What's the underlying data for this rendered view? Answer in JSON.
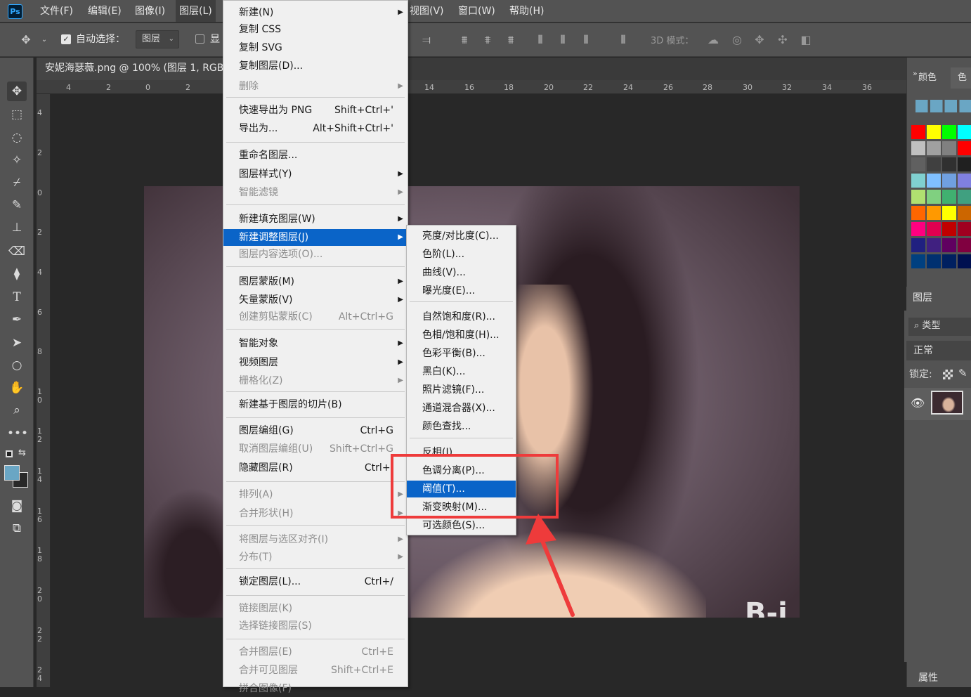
{
  "app": {
    "logo": "Ps"
  },
  "menubar": {
    "items": [
      "文件(F)",
      "编辑(E)",
      "图像(I)",
      "图层(L)",
      "视图(V)",
      "窗口(W)",
      "帮助(H)"
    ]
  },
  "options": {
    "auto_select_label": "自动选择：",
    "layer_select_value": "图层",
    "show_label": "显",
    "mode_3d_label": "3D 模式："
  },
  "document": {
    "tab_title": "安妮海瑟薇.png @ 100% (图层 1, RGB",
    "ruler_h": [
      "4",
      "2",
      "0",
      "2",
      "14",
      "16",
      "18",
      "20",
      "22",
      "24",
      "26",
      "28",
      "30",
      "32",
      "34",
      "36"
    ],
    "ruler_v": [
      "4",
      "2",
      "0",
      "2",
      "4",
      "6",
      "8",
      "1 0",
      "1 2",
      "1 4",
      "1 6",
      "1 8",
      "2 0",
      "2 2",
      "2 4"
    ],
    "watermark": "B-i"
  },
  "right_panel": {
    "tab_color": "颜色",
    "tab_swatches": "色",
    "layers_tab": "图层",
    "filter_label": "类型",
    "blend_mode": "正常",
    "lock_label": "锁定:",
    "properties_tab": "属性"
  },
  "layer_menu": {
    "items": [
      {
        "label": "新建(N)",
        "sc": "",
        "arrow": true,
        "disabled": false
      },
      {
        "label": "复制 CSS",
        "sc": "",
        "arrow": false,
        "disabled": false
      },
      {
        "label": "复制 SVG",
        "sc": "",
        "arrow": false,
        "disabled": false
      },
      {
        "label": "复制图层(D)...",
        "sc": "",
        "arrow": false,
        "disabled": false
      },
      {
        "label": "删除",
        "sc": "",
        "arrow": true,
        "disabled": true
      },
      {
        "label": "快速导出为 PNG",
        "sc": "Shift+Ctrl+'",
        "arrow": false,
        "disabled": false
      },
      {
        "label": "导出为...",
        "sc": "Alt+Shift+Ctrl+'",
        "arrow": false,
        "disabled": false
      },
      {
        "label": "重命名图层...",
        "sc": "",
        "arrow": false,
        "disabled": false
      },
      {
        "label": "图层样式(Y)",
        "sc": "",
        "arrow": true,
        "disabled": false
      },
      {
        "label": "智能滤镜",
        "sc": "",
        "arrow": true,
        "disabled": true
      },
      {
        "label": "新建填充图层(W)",
        "sc": "",
        "arrow": true,
        "disabled": false
      },
      {
        "label": "新建调整图层(J)",
        "sc": "",
        "arrow": true,
        "disabled": false,
        "highlight": true
      },
      {
        "label": "图层内容选项(O)...",
        "sc": "",
        "arrow": false,
        "disabled": true
      },
      {
        "label": "图层蒙版(M)",
        "sc": "",
        "arrow": true,
        "disabled": false
      },
      {
        "label": "矢量蒙版(V)",
        "sc": "",
        "arrow": true,
        "disabled": false
      },
      {
        "label": "创建剪贴蒙版(C)",
        "sc": "Alt+Ctrl+G",
        "arrow": false,
        "disabled": true
      },
      {
        "label": "智能对象",
        "sc": "",
        "arrow": true,
        "disabled": false
      },
      {
        "label": "视频图层",
        "sc": "",
        "arrow": true,
        "disabled": false
      },
      {
        "label": "栅格化(Z)",
        "sc": "",
        "arrow": true,
        "disabled": true
      },
      {
        "label": "新建基于图层的切片(B)",
        "sc": "",
        "arrow": false,
        "disabled": false
      },
      {
        "label": "图层编组(G)",
        "sc": "Ctrl+G",
        "arrow": false,
        "disabled": false
      },
      {
        "label": "取消图层编组(U)",
        "sc": "Shift+Ctrl+G",
        "arrow": false,
        "disabled": true
      },
      {
        "label": "隐藏图层(R)",
        "sc": "Ctrl+,",
        "arrow": false,
        "disabled": false
      },
      {
        "label": "排列(A)",
        "sc": "",
        "arrow": true,
        "disabled": true
      },
      {
        "label": "合并形状(H)",
        "sc": "",
        "arrow": true,
        "disabled": true
      },
      {
        "label": "将图层与选区对齐(I)",
        "sc": "",
        "arrow": true,
        "disabled": true
      },
      {
        "label": "分布(T)",
        "sc": "",
        "arrow": true,
        "disabled": true
      },
      {
        "label": "锁定图层(L)...",
        "sc": "Ctrl+/",
        "arrow": false,
        "disabled": false
      },
      {
        "label": "链接图层(K)",
        "sc": "",
        "arrow": false,
        "disabled": true
      },
      {
        "label": "选择链接图层(S)",
        "sc": "",
        "arrow": false,
        "disabled": true
      },
      {
        "label": "合并图层(E)",
        "sc": "Ctrl+E",
        "arrow": false,
        "disabled": true
      },
      {
        "label": "合并可见图层",
        "sc": "Shift+Ctrl+E",
        "arrow": false,
        "disabled": true
      },
      {
        "label": "拼合图像(F)",
        "sc": "",
        "arrow": false,
        "disabled": true
      }
    ]
  },
  "adjust_submenu": {
    "items": [
      {
        "label": "亮度/对比度(C)..."
      },
      {
        "label": "色阶(L)..."
      },
      {
        "label": "曲线(V)..."
      },
      {
        "label": "曝光度(E)..."
      },
      {
        "label": "自然饱和度(R)..."
      },
      {
        "label": "色相/饱和度(H)..."
      },
      {
        "label": "色彩平衡(B)..."
      },
      {
        "label": "黑白(K)..."
      },
      {
        "label": "照片滤镜(F)..."
      },
      {
        "label": "通道混合器(X)..."
      },
      {
        "label": "颜色查找..."
      },
      {
        "label": "反相(I)"
      },
      {
        "label": "色调分离(P)..."
      },
      {
        "label": "阈值(T)...",
        "highlight": true
      },
      {
        "label": "渐变映射(M)..."
      },
      {
        "label": "可选颜色(S)..."
      }
    ]
  },
  "colors": {
    "menu_highlight": "#0a64c8",
    "annotation_red": "#ee3b3b",
    "fg_color": "#6aa6c4",
    "swatches": [
      "#ff0000",
      "#ffff00",
      "#00ff00",
      "#00ffff",
      "#c0c0c0",
      "#a0a0a0",
      "#808080",
      "#ff0000",
      "#606060",
      "#404040",
      "#303030",
      "#202020",
      "#80d0d0",
      "#80c0ff",
      "#70a0e0",
      "#8080e0",
      "#b0e070",
      "#80d080",
      "#40b070",
      "#40a080",
      "#ff6600",
      "#ff9900",
      "#ffff00",
      "#cc6600",
      "#ff0080",
      "#e00050",
      "#c00000",
      "#a00020",
      "#202080",
      "#402080",
      "#600060",
      "#800040",
      "#004080",
      "#003070",
      "#002060",
      "#001050"
    ]
  }
}
